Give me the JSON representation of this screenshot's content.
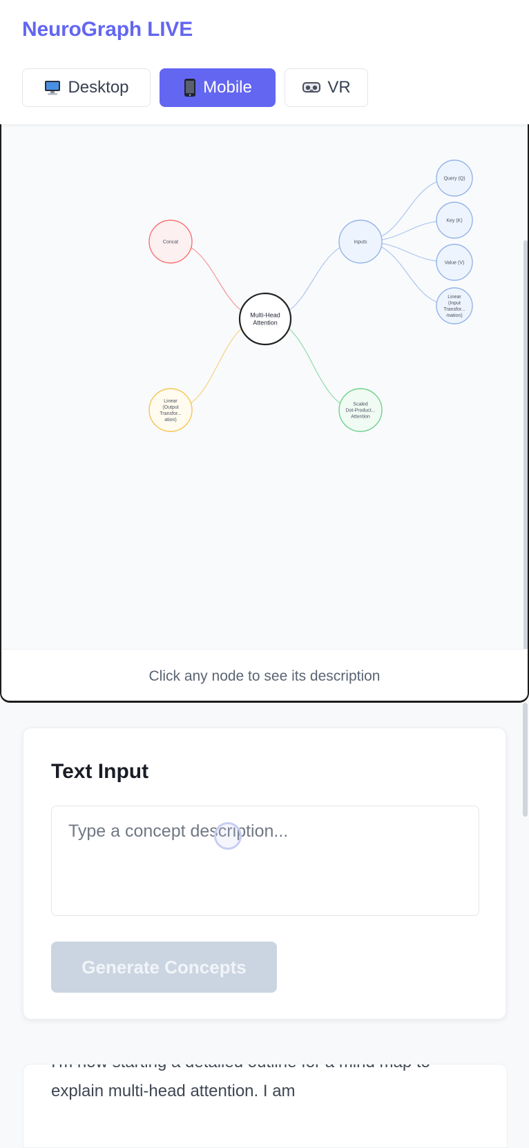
{
  "app": {
    "title": "NeuroGraph LIVE"
  },
  "view_modes": [
    {
      "label": "Desktop",
      "icon": "desktop-monitor-icon",
      "active": false
    },
    {
      "label": "Mobile",
      "icon": "mobile-phone-icon",
      "active": true
    },
    {
      "label": "VR",
      "icon": "vr-goggles-icon",
      "active": false
    }
  ],
  "mind_map": {
    "center": {
      "label": "Multi-Head Attention",
      "color": "#222222"
    },
    "nodes": [
      {
        "id": "concat",
        "label": "Concat",
        "color": "#f87171"
      },
      {
        "id": "inputs",
        "label": "Inputs",
        "color": "#93b4e8"
      },
      {
        "id": "linear_out",
        "label": "Linear (Output Transfor... ation)",
        "color": "#f6c453"
      },
      {
        "id": "scaled_dot",
        "label": "Scaled Dot-Product... Attention",
        "color": "#6fd08c"
      },
      {
        "id": "query",
        "label": "Query (Q)",
        "color": "#93b4e8"
      },
      {
        "id": "key",
        "label": "Key (K)",
        "color": "#93b4e8"
      },
      {
        "id": "value",
        "label": "Value (V)",
        "color": "#93b4e8"
      },
      {
        "id": "linear_in",
        "label": "Linear (Input Transfor... mation)",
        "color": "#93b4e8"
      }
    ],
    "hint": "Click any node to see its description"
  },
  "text_input": {
    "title": "Text Input",
    "placeholder": "Type a concept description...",
    "button_label": "Generate Concepts"
  },
  "thinking": {
    "text": "I'm now starting a detailed outline for a mind map to explain multi-head attention. I am"
  },
  "colors": {
    "accent": "#6366f1",
    "button_disabled": "#cbd5e1"
  }
}
